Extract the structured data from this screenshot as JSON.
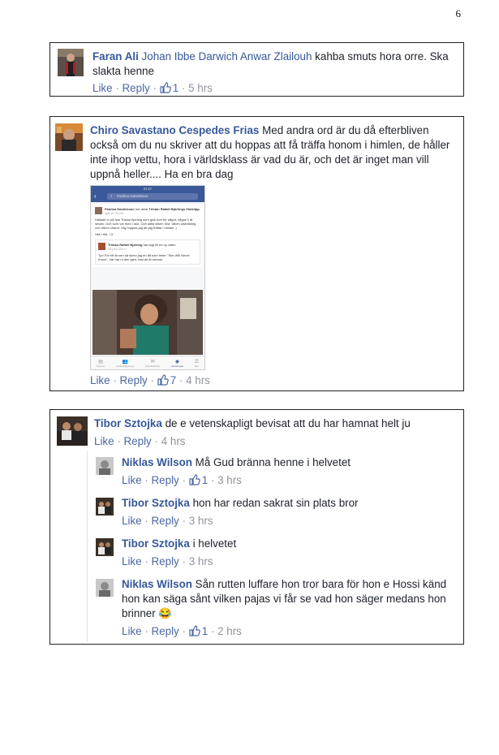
{
  "page_number": "6",
  "comments": [
    {
      "author": "Faran Ali",
      "mention": "Johan Ibbe Darwich Anwar Zlailouh",
      "text": " kahba smuts hora orre. Ska slakta henne",
      "like": "Like",
      "reply": "Reply",
      "likes": "1",
      "time": "5 hrs"
    },
    {
      "author": "Chiro Savastano Cespedes Frias",
      "text": " Med andra ord är du då efterbliven också om du nu skriver att du hoppas att få träffa honom i himlen, de håller inte ihop vettu, hora i världsklass är vad du är, och det är inget man vill uppnå heller.... Ha en bra dag",
      "like": "Like",
      "reply": "Reply",
      "likes": "7",
      "time": "4 hrs",
      "screenshot": {
        "status_time": "07:47",
        "search": "Paulina Danielsson",
        "post_author": "Paulina Danielsson",
        "post_shared": "har delat",
        "post_target": "Tristan Rafaël Björlings filmklipp.",
        "post_date": "Igår kl. 20:44",
        "post_text": "Hallade in på fina Tristan björling som gick bort för något, några?) år sedan. Och som var med i Idol. Och alltid vilken röst, vilken utstrålning och vilken charm. Dig hoppas jag att jag träffar i himlen :)",
        "post_footer": "Vila i frid. <3",
        "inner_author": "Tristan Rafaël Björling",
        "inner_action": "har lagt till en ny video.",
        "inner_date": "26 juni 2014 ·",
        "inner_text": "Tjo! För ett år sen så skrev jag en låt som heter \"She Will Never Know\", här har ni den igen, fast att år senare.",
        "tabs": [
          "Nyheter",
          "Vänförfrågningar",
          "Meddelanden",
          "Aviseringar",
          "Mer"
        ]
      }
    },
    {
      "author": "Tibor Sztojka",
      "text": " de e vetenskapligt bevisat att du har hamnat helt ju",
      "like": "Like",
      "reply": "Reply",
      "time": "4 hrs",
      "replies": [
        {
          "author": "Niklas Wilson",
          "text": " Må Gud bränna henne i helvetet",
          "like": "Like",
          "reply": "Reply",
          "likes": "1",
          "time": "3 hrs"
        },
        {
          "author": "Tibor Sztojka",
          "text": " hon har redan sakrat sin plats bror",
          "like": "Like",
          "reply": "Reply",
          "time": "3 hrs"
        },
        {
          "author": "Tibor Sztojka",
          "text": " i helvetet",
          "like": "Like",
          "reply": "Reply",
          "time": "3 hrs"
        },
        {
          "author": "Niklas Wilson",
          "text": " Sån rutten luffare hon tror bara för hon e Hossi känd hon kan säga sånt vilken pajas vi får se vad hon säger medans hon brinner",
          "emoji": "😂",
          "like": "Like",
          "reply": "Reply",
          "likes": "1",
          "time": "2 hrs"
        }
      ]
    }
  ]
}
